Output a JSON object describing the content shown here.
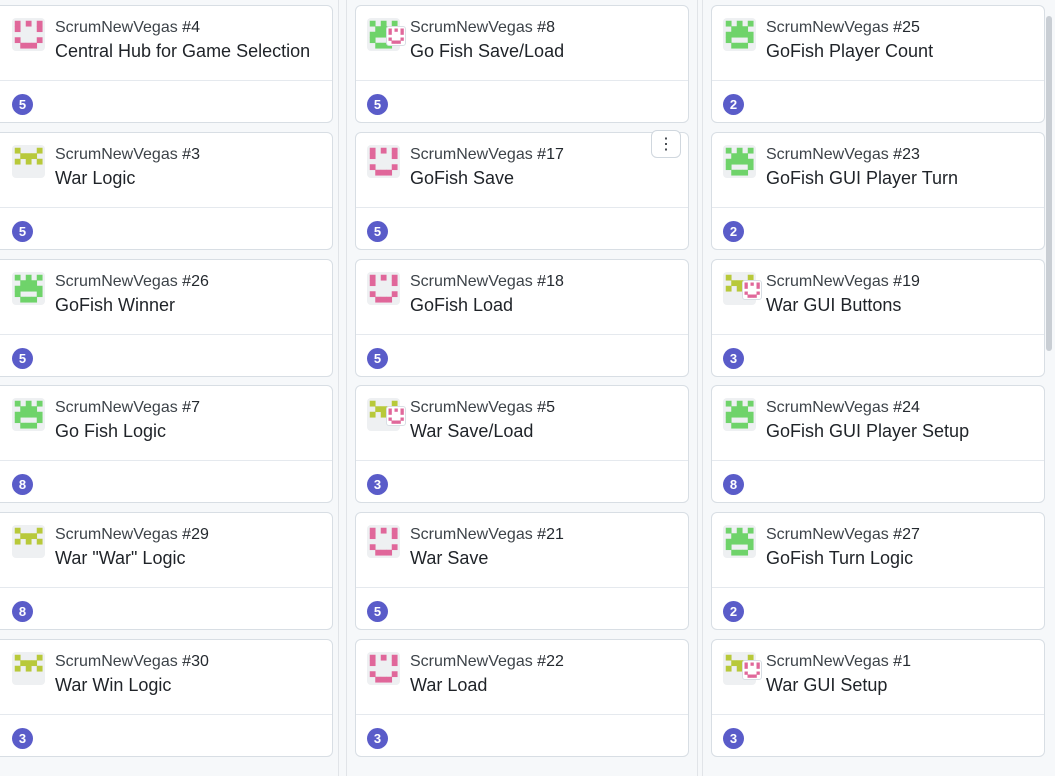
{
  "columns": [
    {
      "cards": [
        {
          "repo": "ScrumNewVegas",
          "number": "#4",
          "title": "Central Hub for Game Selection",
          "points": "5",
          "avatar": "pink-identicon",
          "secondary": null
        },
        {
          "repo": "ScrumNewVegas",
          "number": "#3",
          "title": "War Logic",
          "points": "5",
          "avatar": "olive-identicon",
          "secondary": null
        },
        {
          "repo": "ScrumNewVegas",
          "number": "#26",
          "title": "GoFish Winner",
          "points": "5",
          "avatar": "green-identicon",
          "secondary": null
        },
        {
          "repo": "ScrumNewVegas",
          "number": "#7",
          "title": "Go Fish Logic",
          "points": "8",
          "avatar": "green-identicon",
          "secondary": null
        },
        {
          "repo": "ScrumNewVegas",
          "number": "#29",
          "title": "War \"War\" Logic",
          "points": "8",
          "avatar": "olive-identicon",
          "secondary": null
        },
        {
          "repo": "ScrumNewVegas",
          "number": "#30",
          "title": "War Win Logic",
          "points": "3",
          "avatar": "olive-identicon",
          "secondary": null
        }
      ]
    },
    {
      "cards": [
        {
          "repo": "ScrumNewVegas",
          "number": "#8",
          "title": "Go Fish Save/Load",
          "points": "5",
          "avatar": "green-identicon",
          "secondary": "pink-identicon"
        },
        {
          "repo": "ScrumNewVegas",
          "number": "#17",
          "title": "GoFish Save",
          "points": "5",
          "avatar": "pink-identicon",
          "secondary": null
        },
        {
          "repo": "ScrumNewVegas",
          "number": "#18",
          "title": "GoFish Load",
          "points": "5",
          "avatar": "pink-identicon",
          "secondary": null
        },
        {
          "repo": "ScrumNewVegas",
          "number": "#5",
          "title": "War Save/Load",
          "points": "3",
          "avatar": "olive-identicon",
          "secondary": "pink-identicon"
        },
        {
          "repo": "ScrumNewVegas",
          "number": "#21",
          "title": "War Save",
          "points": "5",
          "avatar": "pink-identicon",
          "secondary": null
        },
        {
          "repo": "ScrumNewVegas",
          "number": "#22",
          "title": "War Load",
          "points": "3",
          "avatar": "pink-identicon",
          "secondary": null
        }
      ]
    },
    {
      "cards": [
        {
          "repo": "ScrumNewVegas",
          "number": "#25",
          "title": "GoFish Player Count",
          "points": "2",
          "avatar": "green-identicon",
          "secondary": null
        },
        {
          "repo": "ScrumNewVegas",
          "number": "#23",
          "title": "GoFish GUI Player Turn",
          "points": "2",
          "avatar": "green-identicon",
          "secondary": null
        },
        {
          "repo": "ScrumNewVegas",
          "number": "#19",
          "title": "War GUI Buttons",
          "points": "3",
          "avatar": "olive-identicon",
          "secondary": "pink-identicon"
        },
        {
          "repo": "ScrumNewVegas",
          "number": "#24",
          "title": "GoFish GUI Player Setup",
          "points": "8",
          "avatar": "green-identicon",
          "secondary": null
        },
        {
          "repo": "ScrumNewVegas",
          "number": "#27",
          "title": "GoFish Turn Logic",
          "points": "2",
          "avatar": "green-identicon",
          "secondary": null
        },
        {
          "repo": "ScrumNewVegas",
          "number": "#1",
          "title": "War GUI Setup",
          "points": "3",
          "avatar": "olive-identicon",
          "secondary": "pink-identicon"
        }
      ]
    }
  ],
  "kebab_label": "⋮",
  "colors": {
    "badge": "#5a5cc9",
    "pink": "#e0679a",
    "green": "#6fd36a",
    "olive": "#b8c93a"
  }
}
